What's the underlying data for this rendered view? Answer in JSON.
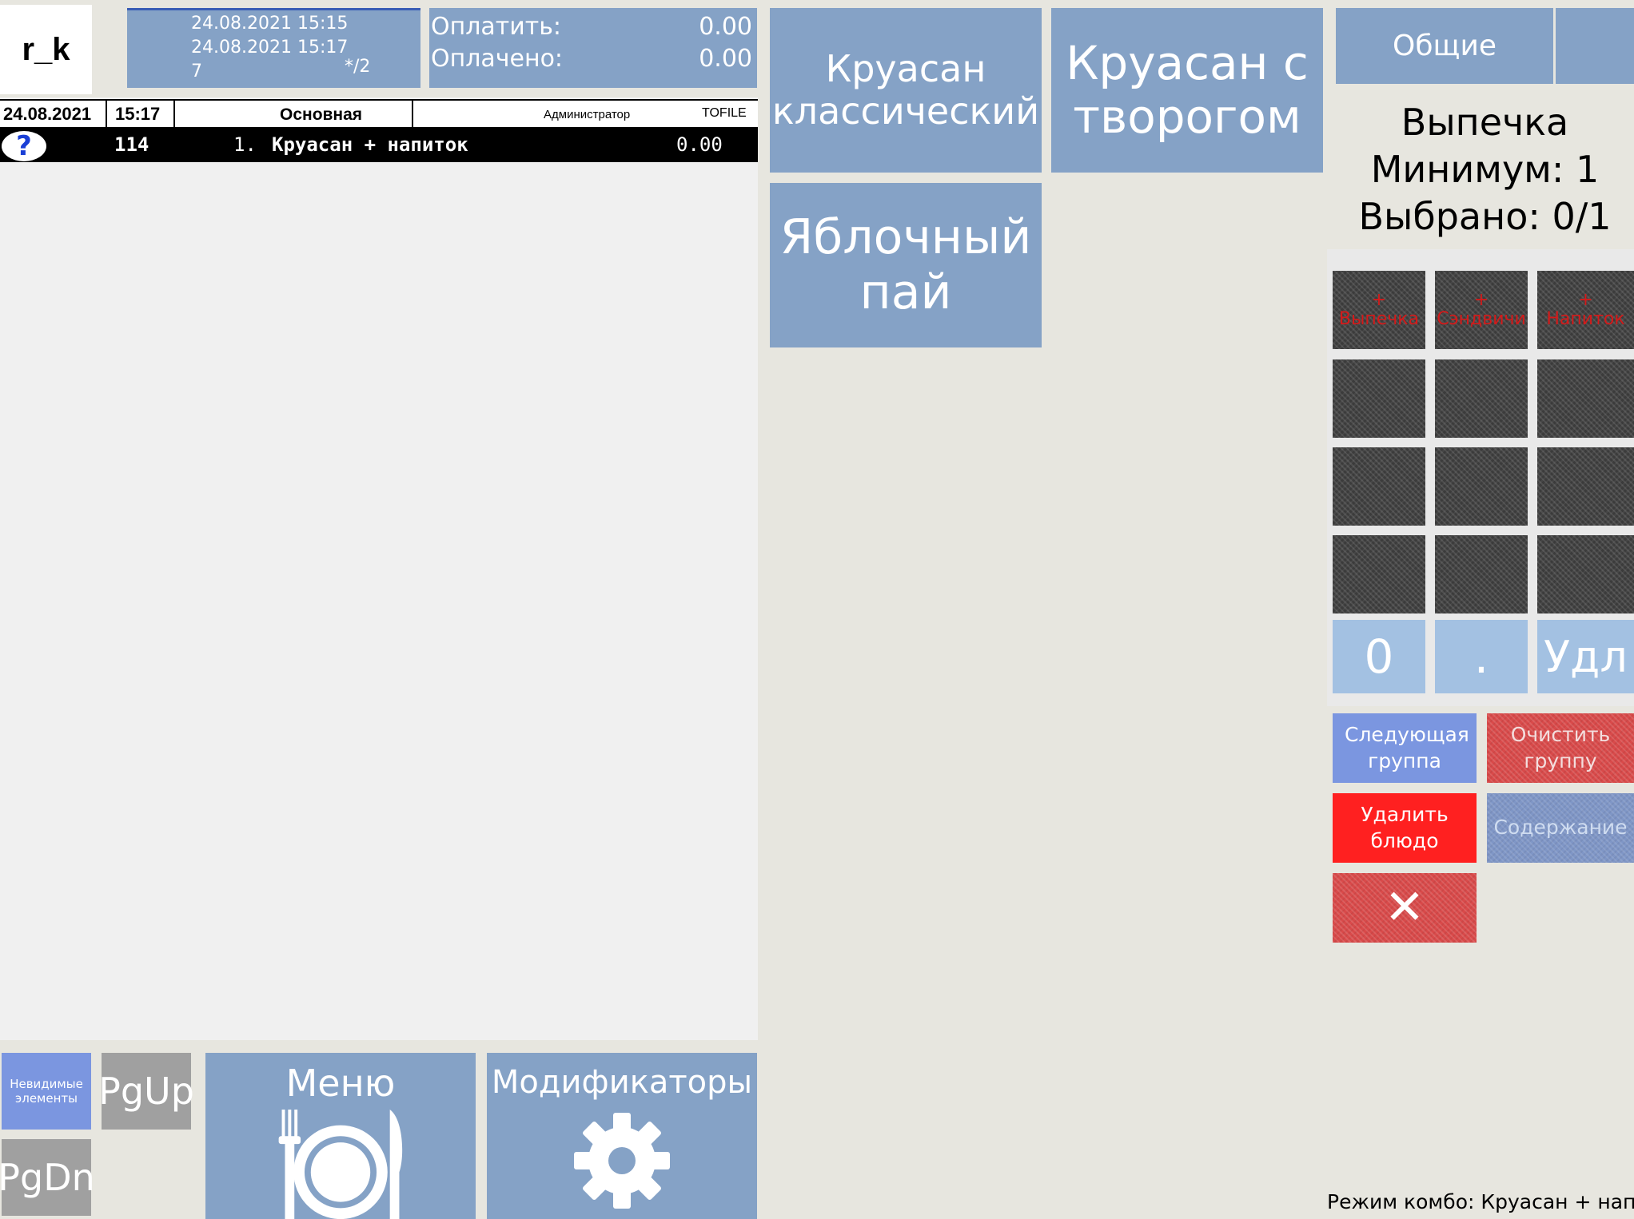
{
  "header": {
    "user_logo": "r_k",
    "open_time": "24.08.2021 15:15",
    "current_time": "24.08.2021 15:17",
    "guests": "7",
    "table_ratio": "*/2",
    "pay_label": "Оплатить:",
    "pay_value": "0.00",
    "paid_label": "Оплачено:",
    "paid_value": "0.00"
  },
  "order_header": {
    "date": "24.08.2021",
    "time": "15:17",
    "menu_type": "Основная",
    "role": "Администратор",
    "source": "TOFILE"
  },
  "order_items": [
    {
      "icon": "?",
      "code": "114",
      "index": "1.",
      "name": "Круасан + напиток",
      "price": "0.00"
    }
  ],
  "dishes": [
    {
      "name": "Круасан классический"
    },
    {
      "name": "Круасан с творогом"
    },
    {
      "name": "Яблочный пай"
    }
  ],
  "right_panel": {
    "tab_general": "Общие",
    "group_name": "Выпечка",
    "minimum": "Минимум: 1",
    "selected": "Выбрано: 0/1",
    "categories": [
      {
        "plus": "+",
        "name": "Выпечка"
      },
      {
        "plus": "+",
        "name": "Сэндвичи"
      },
      {
        "plus": "+",
        "name": "Напиток"
      }
    ],
    "num_zero": "0",
    "num_dot": ".",
    "num_delete": "Удл",
    "next_group": "Следующая группа",
    "clear_group": "Очистить группу",
    "delete_dish": "Удалить блюдо",
    "contents": "Содержание",
    "cancel_symbol": "✕"
  },
  "bottom": {
    "invisible_items": "Невидимые элементы",
    "pgup": "PgUp",
    "pgdn": "PgDn",
    "menu": "Меню",
    "modifiers": "Модификаторы"
  },
  "status": "Режим комбо: Круасан + напиток",
  "colors": {
    "tile_blue": "#85a2c6",
    "background": "#e7e6df",
    "order_bg": "#f0f0f0",
    "delete_red": "#ff2020",
    "next_blue": "#7b96e0"
  }
}
